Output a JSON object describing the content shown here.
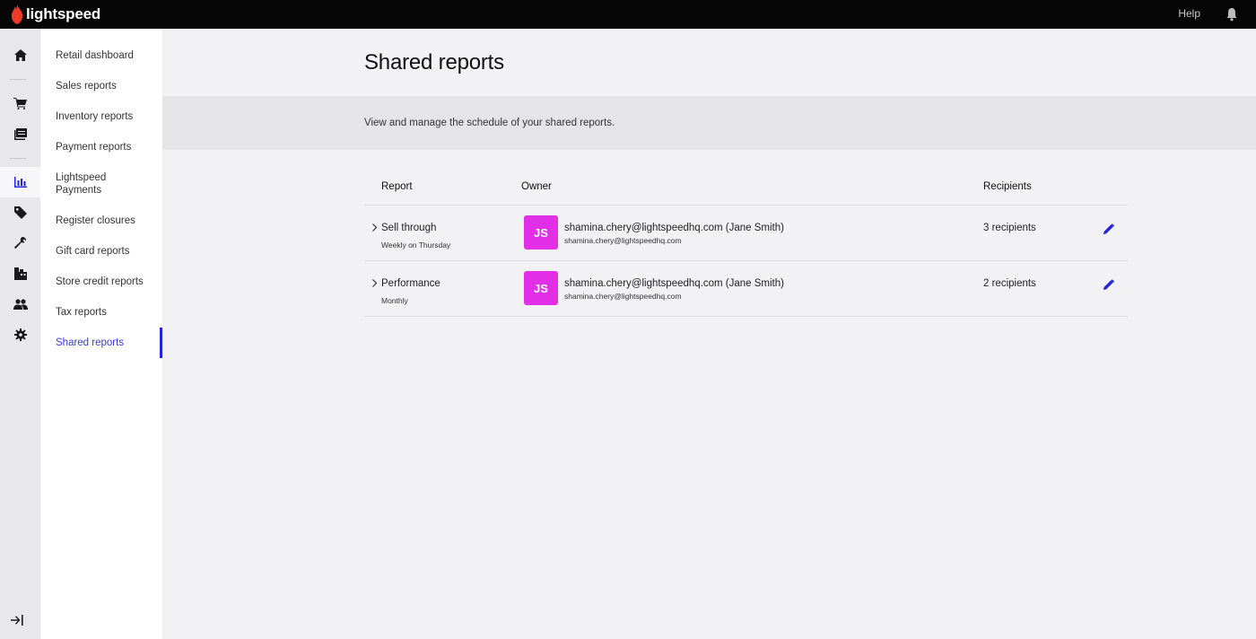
{
  "app": {
    "brand": "lightspeed",
    "help_label": "Help",
    "accent_color": "#2323d9",
    "avatar_color": "#e02fe6"
  },
  "rail": {
    "icons": [
      "home-icon",
      "cart-icon",
      "catalog-icon",
      "reports-icon",
      "tag-icon",
      "wrench-icon",
      "inventory-icon",
      "customers-icon",
      "settings-icon",
      "collapse-icon"
    ],
    "active": "reports-icon"
  },
  "subnav": {
    "items": [
      {
        "label": "Retail dashboard"
      },
      {
        "label": "Sales reports"
      },
      {
        "label": "Inventory reports"
      },
      {
        "label": "Payment reports"
      },
      {
        "label": "Lightspeed Payments"
      },
      {
        "label": "Register closures"
      },
      {
        "label": "Gift card reports"
      },
      {
        "label": "Store credit reports"
      },
      {
        "label": "Tax reports"
      },
      {
        "label": "Shared reports"
      }
    ],
    "active": "Shared reports"
  },
  "page": {
    "title": "Shared reports",
    "description": "View and manage the schedule of your shared reports."
  },
  "table": {
    "columns": {
      "report": "Report",
      "owner": "Owner",
      "recipients": "Recipients"
    },
    "rows": [
      {
        "name": "Sell through",
        "schedule": "Weekly on Thursday",
        "initials": "JS",
        "owner_name": "shamina.chery@lightspeedhq.com (Jane Smith)",
        "owner_email": "shamina.chery@lightspeedhq.com",
        "recipients": "3 recipients"
      },
      {
        "name": "Performance",
        "schedule": "Monthly",
        "initials": "JS",
        "owner_name": "shamina.chery@lightspeedhq.com (Jane Smith)",
        "owner_email": "shamina.chery@lightspeedhq.com",
        "recipients": "2 recipients"
      }
    ]
  }
}
